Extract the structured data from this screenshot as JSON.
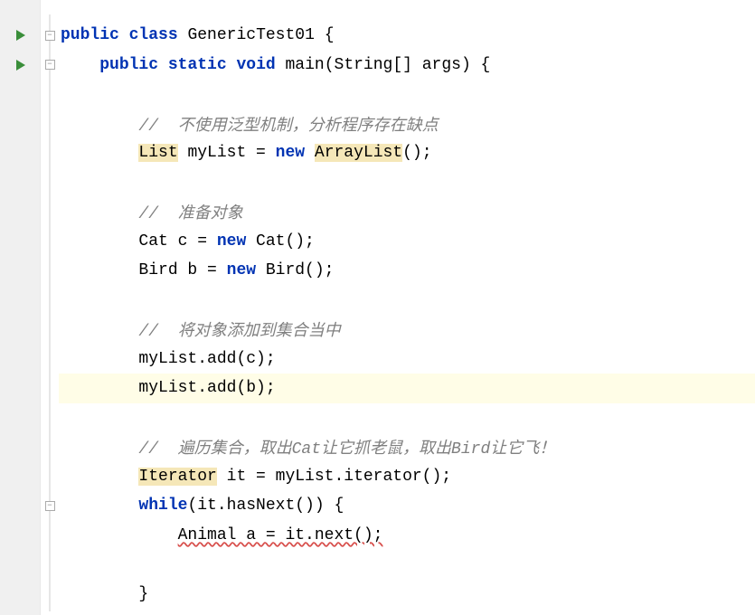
{
  "code": {
    "line1": {
      "k1": "public",
      "k2": "class",
      "name": "GenericTest01",
      "brace": "{"
    },
    "line2": {
      "k1": "public",
      "k2": "static",
      "k3": "void",
      "method": "main",
      "params": "(String[] args) {"
    },
    "comment1": "//  不使用泛型机制，分析程序存在缺点",
    "line5": {
      "type": "List",
      "var": " myList = ",
      "kw": "new",
      "cls": "ArrayList",
      "end": "();"
    },
    "comment2": "//  准备对象",
    "line8": {
      "p1": "Cat c = ",
      "kw": "new",
      "p2": " Cat();"
    },
    "line9": {
      "p1": "Bird b = ",
      "kw": "new",
      "p2": " Bird();"
    },
    "comment3": "//  将对象添加到集合当中",
    "line12": "myList.add(c);",
    "line13": "myList.add(b);",
    "comment4": "//  遍历集合，取出Cat让它抓老鼠，取出Bird让它飞！",
    "line16": {
      "type": "Iterator",
      "rest": " it = myList.iterator();"
    },
    "line17": {
      "kw": "while",
      "rest": "(it.hasNext()) {"
    },
    "line18": "Animal a = it.next();",
    "line20": "}"
  },
  "icons": {
    "run": "run-triangle",
    "fold_minus": "−"
  }
}
